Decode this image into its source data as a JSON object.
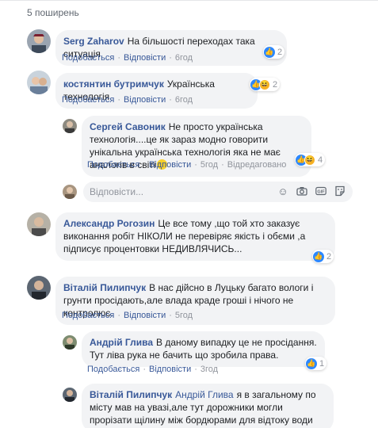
{
  "shares": "5 поширень",
  "actions": {
    "like": "Подобається",
    "reply": "Відповісти",
    "edited": "Відредаговано"
  },
  "reply_box": {
    "placeholder": "Відповісти..."
  },
  "comments": [
    {
      "author": "Serg Zaharov",
      "text": "На більшості переходах така ситуація",
      "time": "6год",
      "reactions": "2",
      "reaction_icons": [
        "like-icon"
      ]
    },
    {
      "author": "костянтин бутримчук",
      "text": "Українська технологія",
      "time": "6год",
      "reactions": "2",
      "reaction_icons": [
        "like-icon",
        "haha-icon"
      ]
    },
    {
      "author": "Сергей Савоник",
      "text": "Не просто українська технологія....це як зараз модно говорити унікальна українська технологія яка не має аналогів в світі",
      "time": "5год",
      "reactions": "4",
      "reaction_icons": [
        "like-icon",
        "haha-icon"
      ],
      "emoji": "smile-emoji"
    },
    {
      "author": "Александр Рогозин",
      "text": "Це все тому ,що той хто заказує виконання робіт НІКОЛИ не перевіряє якість і обєми ,а підписує процентовки НЕДИВЛЯЧИСЬ...",
      "reactions": "2",
      "reaction_icons": [
        "like-icon"
      ]
    },
    {
      "author": "Віталій Пилипчук",
      "text": "В нас дійсно в Луцьку багато вологи і грунти просідають,але влада краде гроші і нічого не контролює.",
      "time": "5год"
    },
    {
      "author": "Андрій Глива",
      "text": "В даному випадку це не просідання. Тут ліва рука не бачить що зробила права.",
      "time": "3год",
      "reactions": "1",
      "reaction_icons": [
        "like-icon"
      ]
    },
    {
      "author": "Віталій Пилипчук",
      "tag": "Андрій Глива",
      "text": "я в загальному по місту мав на увазі,але тут дорожники могли прорізати щілину між бордюрами для відтоку води"
    }
  ]
}
